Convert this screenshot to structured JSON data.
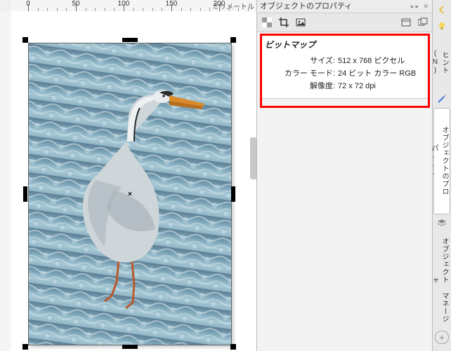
{
  "ruler": {
    "unit_label": "ミリメートル",
    "major_ticks": [
      0,
      50,
      100,
      150,
      200
    ]
  },
  "panel": {
    "title": "オブジェクトのプロパティ",
    "section_heading": "ビットマップ",
    "rows": {
      "size_label": "サイズ:",
      "size_value": "512 x 768 ピクセル",
      "mode_label": "カラー モード:",
      "mode_value": "24 ビット カラー  RGB",
      "res_label": "解像度:",
      "res_value": "72 x 72 dpi"
    }
  },
  "side_tabs": {
    "hint": "ヒント(N)",
    "props": "オブジェクトのプロパ...",
    "mgr": "オブジェクト マネージャ"
  },
  "icons": {
    "transparency": "transparency-icon",
    "crop": "crop-icon",
    "image": "image-icon",
    "window": "window-icon",
    "doublewin": "double-window-icon",
    "back": "back-arrow-icon",
    "bulb": "lightbulb-icon",
    "wand": "wand-icon",
    "layers": "layers-icon",
    "plus": "add-tab-icon"
  }
}
